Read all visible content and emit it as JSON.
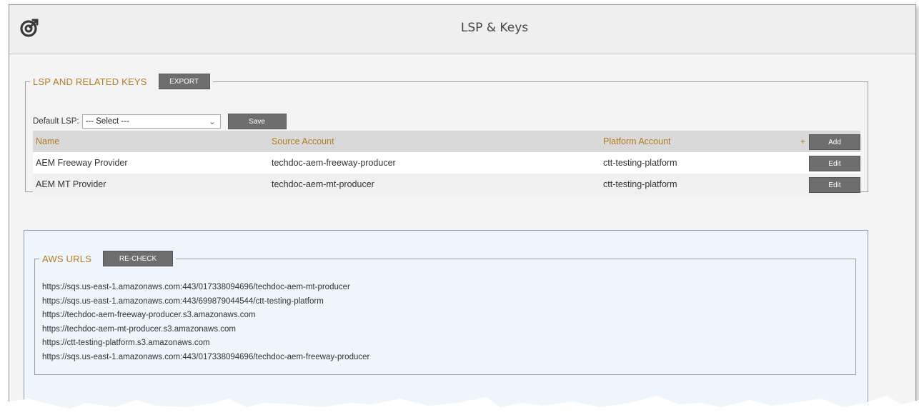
{
  "header": {
    "title": "LSP & Keys"
  },
  "lsp": {
    "legend": "LSP AND RELATED KEYS",
    "export_label": "EXPORT",
    "default_label": "Default LSP:",
    "select_value": "--- Select ---",
    "save_label": "Save",
    "columns": {
      "name": "Name",
      "source": "Source Account",
      "platform": "Platform Account"
    },
    "plus": "+",
    "add_label": "Add",
    "rows": [
      {
        "name": "AEM Freeway Provider",
        "source": "techdoc-aem-freeway-producer",
        "platform": "ctt-testing-platform",
        "action": "Edit"
      },
      {
        "name": "AEM MT Provider",
        "source": "techdoc-aem-mt-producer",
        "platform": "ctt-testing-platform",
        "action": "Edit"
      }
    ]
  },
  "aws": {
    "legend": "AWS URLS",
    "recheck_label": "RE-CHECK",
    "urls": [
      "https://sqs.us-east-1.amazonaws.com:443/017338094696/techdoc-aem-mt-producer",
      "https://sqs.us-east-1.amazonaws.com:443/699879044544/ctt-testing-platform",
      "https://techdoc-aem-freeway-producer.s3.amazonaws.com",
      "https://techdoc-aem-mt-producer.s3.amazonaws.com",
      "https://ctt-testing-platform.s3.amazonaws.com",
      "https://sqs.us-east-1.amazonaws.com:443/017338094696/techdoc-aem-freeway-producer"
    ]
  },
  "icons": {
    "logo": "app-logo-icon",
    "dropdown": "chevron-down-icon"
  },
  "colors": {
    "accent": "#b27a26",
    "button": "#6e6e6e",
    "aws_panel_bg": "#eef5fb"
  }
}
